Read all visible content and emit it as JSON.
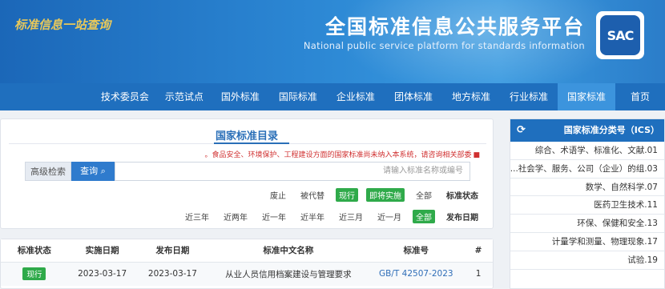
{
  "header": {
    "logo_text": "SAC",
    "title": "全国标准信息公共服务平台",
    "subtitle": "National public service platform  for standards information",
    "slogan": "标准信息一站查询"
  },
  "nav": [
    {
      "label": "首页",
      "active": false
    },
    {
      "label": "国家标准",
      "active": true
    },
    {
      "label": "行业标准",
      "active": false
    },
    {
      "label": "地方标准",
      "active": false
    },
    {
      "label": "团体标准",
      "active": false
    },
    {
      "label": "企业标准",
      "active": false
    },
    {
      "label": "国际标准",
      "active": false
    },
    {
      "label": "国外标准",
      "active": false
    },
    {
      "label": "示范试点",
      "active": false
    },
    {
      "label": "技术委员会",
      "active": false
    }
  ],
  "catalog": {
    "title": "国家标准目录",
    "notice": "食品安全、环境保护、工程建设方面的国家标准尚未纳入本系统，请咨询相关部委。",
    "search_placeholder": "请输入标准名称或编号",
    "search_button": "查询",
    "advanced_button": "高级检索",
    "status_label": "标准状态",
    "status_options": [
      "全部",
      "即将实施",
      "现行",
      "被代替",
      "废止"
    ],
    "date_label": "发布日期",
    "date_options": [
      "全部",
      "近一月",
      "近三月",
      "近半年",
      "近一年",
      "近两年",
      "近三年"
    ]
  },
  "results_table": {
    "columns": [
      "#",
      "标准号",
      "标准中文名称",
      "发布日期",
      "实施日期",
      "标准状态"
    ],
    "rows": [
      {
        "index": "1",
        "code": "GB/T 42507-2023",
        "name": "从业人员信用档案建设与管理要求",
        "published": "2023-03-17",
        "effective": "2023-03-17",
        "status": "现行"
      }
    ]
  },
  "ics": {
    "title": "国家标准分类号（ICS）",
    "items": [
      "01.综合、术语学、标准化、文献",
      "03.社会学、服务、公司（企业）的组...",
      "07.数学、自然科学",
      "11.医药卫生技术",
      "13.环保、保健和安全",
      "17.计量学和测量、物理现象",
      "19.试验"
    ]
  }
}
